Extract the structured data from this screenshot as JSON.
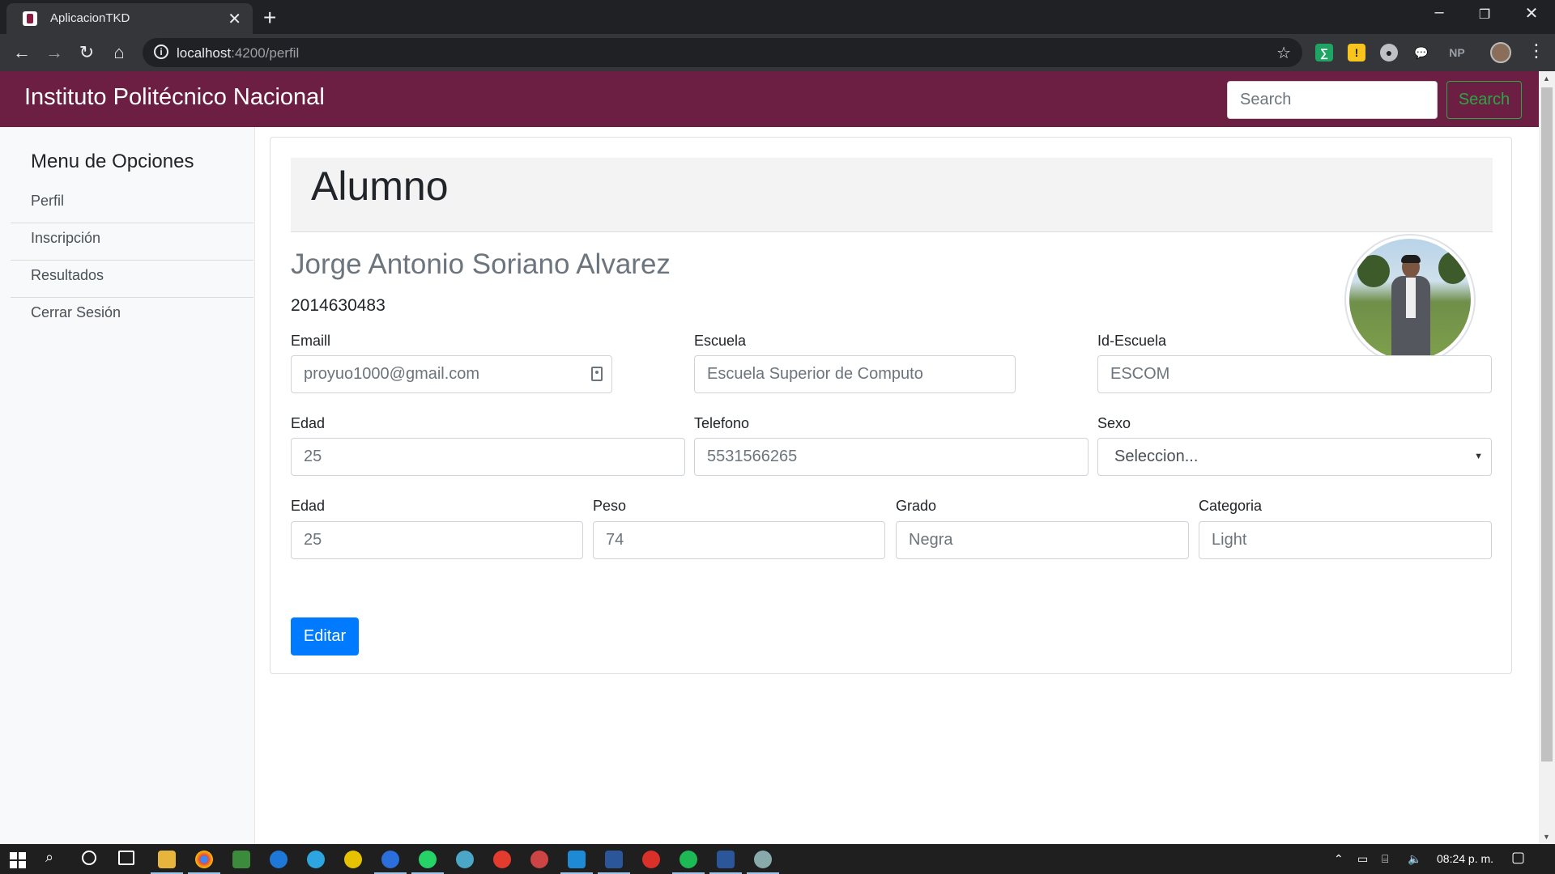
{
  "browser": {
    "tab_title": "AplicacionTKD",
    "url_host": "localhost",
    "url_rest": ":4200/perfil",
    "extensions": [
      "sheets-extension-icon",
      "note-extension-icon",
      "record-extension-icon",
      "chat-extension-icon",
      "NP"
    ]
  },
  "navbar": {
    "brand": "Instituto Politécnico Nacional",
    "search_placeholder": "Search",
    "search_button": "Search"
  },
  "sidebar": {
    "title": "Menu de Opciones",
    "items": [
      {
        "label": "Perfil"
      },
      {
        "label": "Inscripción"
      },
      {
        "label": "Resultados"
      },
      {
        "label": "Cerrar Sesión"
      }
    ]
  },
  "profile": {
    "heading": "Alumno",
    "name": "Jorge Antonio Soriano Alvarez",
    "boleta": "2014630483",
    "fields": {
      "email": {
        "label": "Emaill",
        "placeholder": "proyuo1000@gmail.com"
      },
      "escuela": {
        "label": "Escuela",
        "placeholder": "Escuela Superior de Computo"
      },
      "id_escuela": {
        "label": "Id-Escuela",
        "placeholder": "ESCOM"
      },
      "edad": {
        "label": "Edad",
        "placeholder": "25"
      },
      "telefono": {
        "label": "Telefono",
        "placeholder": "5531566265"
      },
      "sexo": {
        "label": "Sexo",
        "selected": "Seleccion..."
      },
      "edad2": {
        "label": "Edad",
        "placeholder": "25"
      },
      "peso": {
        "label": "Peso",
        "placeholder": "74"
      },
      "grado": {
        "label": "Grado",
        "placeholder": "Negra"
      },
      "categoria": {
        "label": "Categoria",
        "placeholder": "Light"
      }
    },
    "edit_button": "Editar"
  },
  "taskbar": {
    "clock": "08:24 p. m."
  },
  "colors": {
    "navbar": "#6d1f43",
    "primary": "#007bff",
    "success": "#28a745"
  }
}
